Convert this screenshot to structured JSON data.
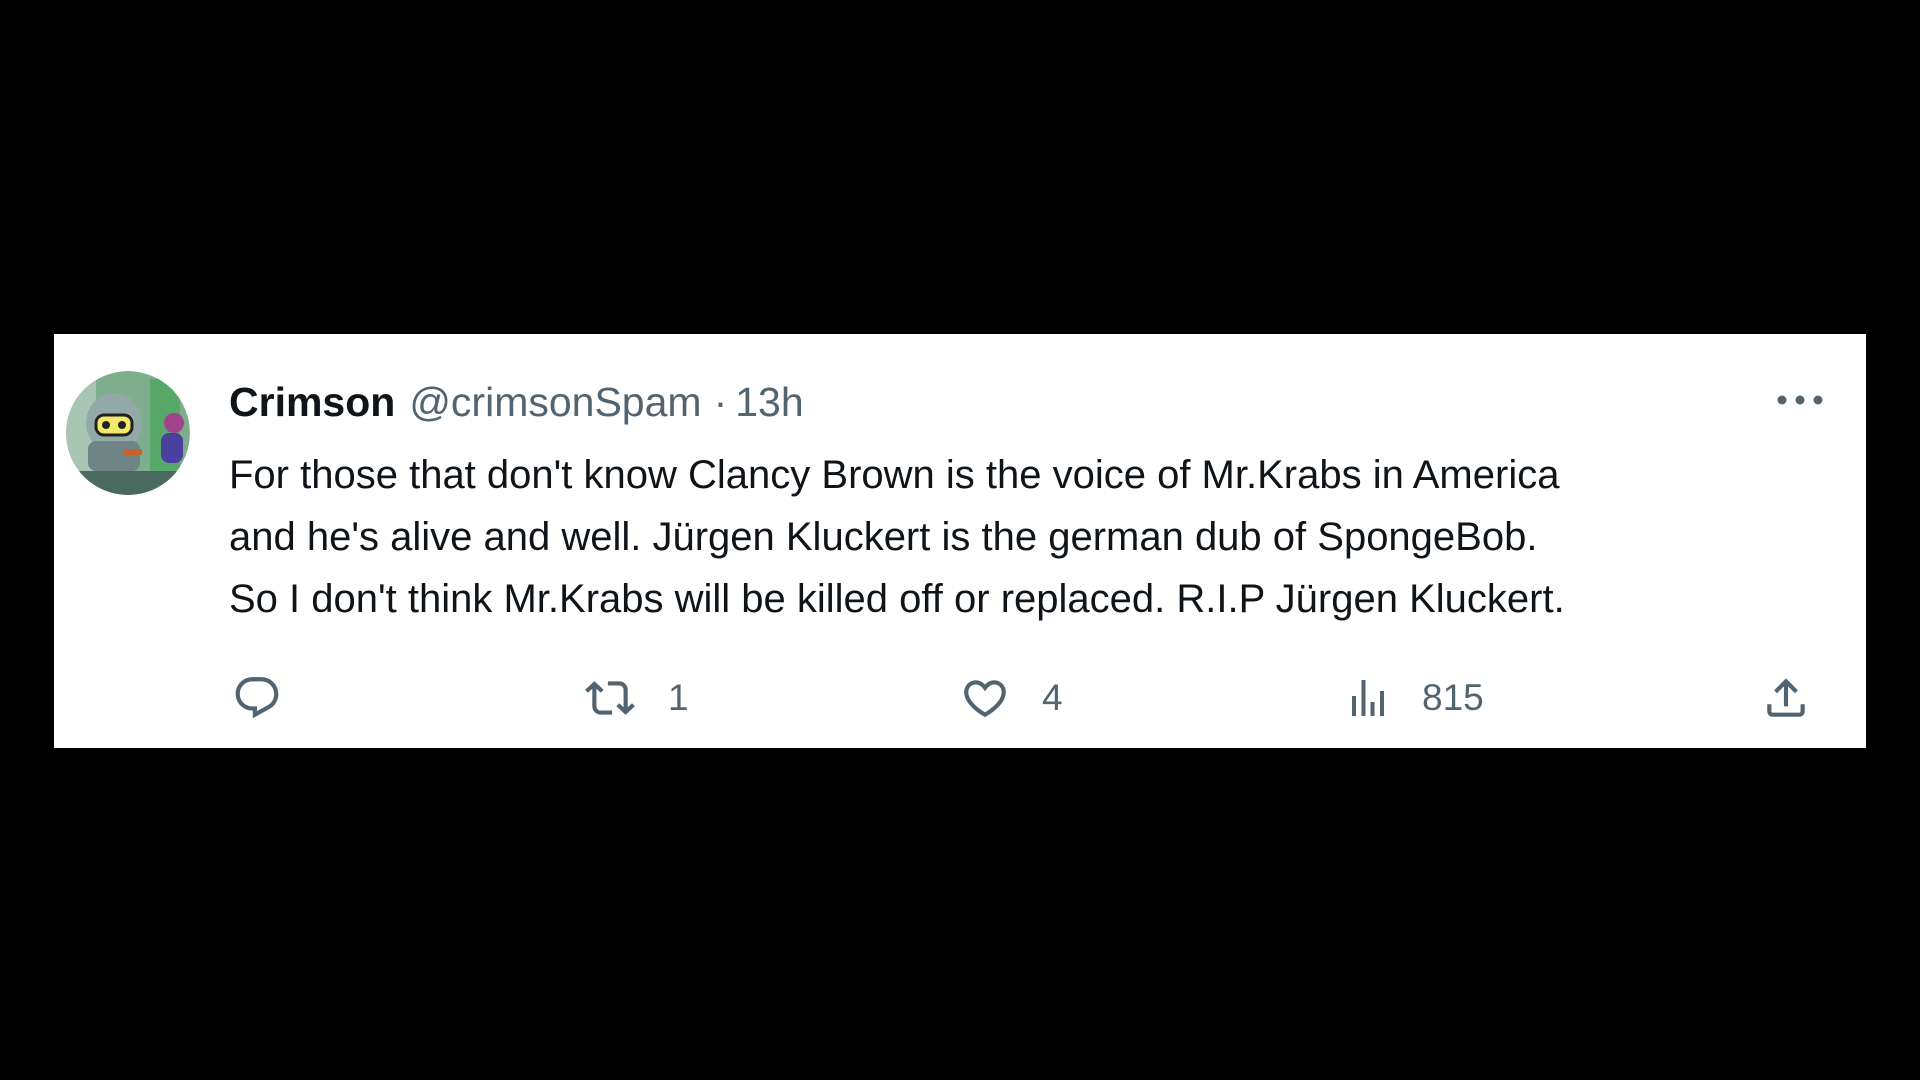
{
  "tweet": {
    "author": {
      "display_name": "Crimson",
      "handle": "@crimsonSpam",
      "avatar_icon": "cartoon-robot-avatar"
    },
    "separator": "·",
    "timestamp": "13h",
    "text_lines": [
      "For those that don't know Clancy Brown is the voice of Mr.Krabs in America",
      "and he's alive and well. Jürgen Kluckert is the german dub of SpongeBob.",
      "So I don't think Mr.Krabs will be killed off or replaced. R.I.P Jürgen Kluckert."
    ],
    "actions": {
      "reply": {
        "icon": "reply-icon",
        "count": ""
      },
      "retweet": {
        "icon": "retweet-icon",
        "count": "1"
      },
      "like": {
        "icon": "heart-icon",
        "count": "4"
      },
      "views": {
        "icon": "views-bar-chart-icon",
        "count": "815"
      },
      "share": {
        "icon": "share-icon"
      }
    },
    "more_icon": "more-options-icon"
  },
  "colors": {
    "background": "#000000",
    "card": "#ffffff",
    "text_primary": "#0f1419",
    "text_secondary": "#536471"
  }
}
